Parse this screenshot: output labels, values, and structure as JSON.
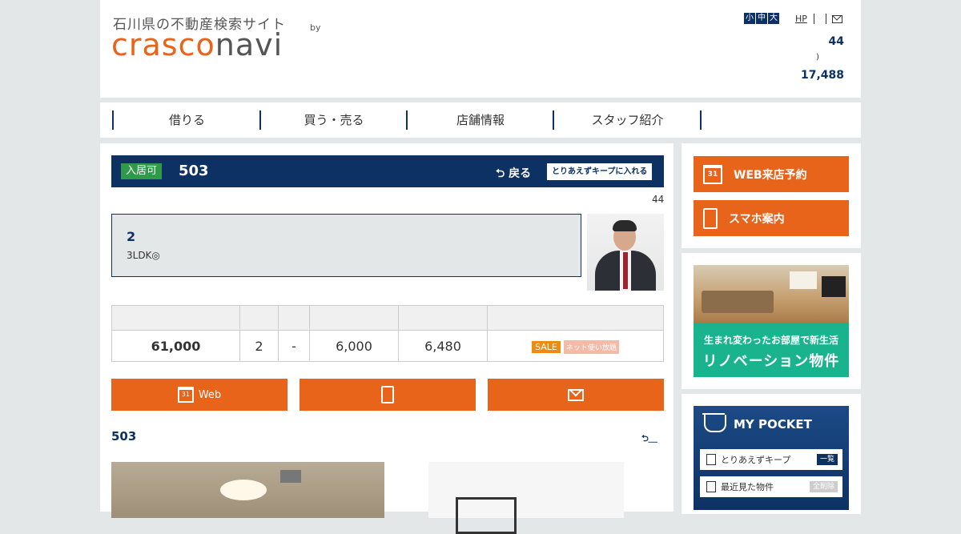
{
  "header": {
    "tagline": "石川県の不動産検索サイト",
    "logo_a": "crasco",
    "logo_b": "navi",
    "by": "by",
    "font_sizes": [
      "小",
      "中",
      "大"
    ],
    "hp": "HP",
    "count_top": "44",
    "paren": ")",
    "count_bottom": "17,488"
  },
  "nav": {
    "items": [
      "借りる",
      "買う・売る",
      "店舗情報",
      "スタッフ紹介"
    ]
  },
  "property": {
    "badge": "入居可",
    "room": "503",
    "back": "戻る",
    "keep": "とりあえずキープに入れる",
    "photo_count": "44",
    "info_title": "2",
    "info_sub": "3LDK◎"
  },
  "prices": {
    "rent": "61,000",
    "col2": "2",
    "col3": "-",
    "col4": "6,000",
    "col5": "6,480",
    "sale": "SALE",
    "net": "ネット使い放題"
  },
  "actions": {
    "web": "Web",
    "cal_day": "31"
  },
  "section2": {
    "title": "503",
    "back": "⮌＿"
  },
  "side": {
    "web_reserve": "WEB来店予約",
    "mobile": "スマホ案内",
    "banner_a": "生まれ変わったお部屋で新生活",
    "banner_b": "リノベーション物件",
    "pocket_title": "MY POCKET",
    "pocket_keep": "とりあえずキープ",
    "pocket_keep_tag": "一覧",
    "pocket_recent": "最近見た物件",
    "pocket_recent_tag": "全削除"
  },
  "colors": {
    "navy": "#0d3163",
    "orange": "#e8641b",
    "green": "#2e9a4a",
    "teal": "#19b38e"
  }
}
